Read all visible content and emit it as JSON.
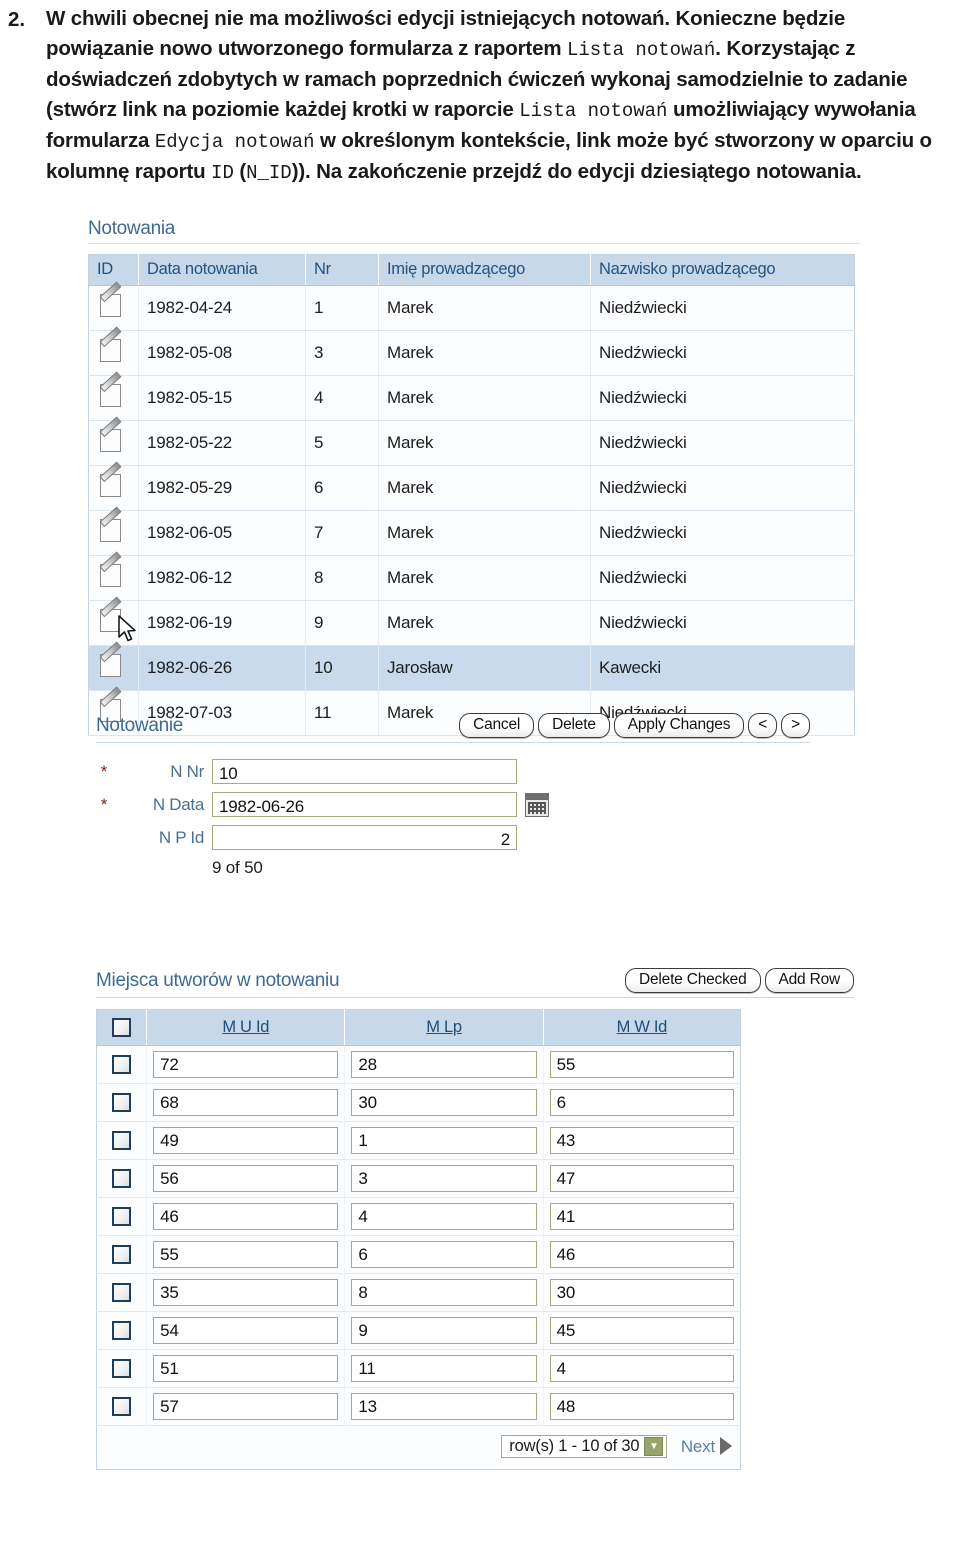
{
  "instruction": {
    "number": "2.",
    "segments": [
      {
        "t": "W chwili obecnej nie ma możliwości edycji istniejących notowań. Konieczne będzie powiązanie nowo utworzonego formularza z raportem ",
        "mono": false
      },
      {
        "t": "Lista notowań",
        "mono": true
      },
      {
        "t": ". Korzystając z doświadczeń zdobytych w ramach poprzednich ćwiczeń wykonaj samodzielnie to zadanie (stwórz link na poziomie każdej krotki w raporcie ",
        "mono": false
      },
      {
        "t": "Lista notowań",
        "mono": true
      },
      {
        "t": " umożliwiający wywołania formularza ",
        "mono": false
      },
      {
        "t": "Edycja notowań",
        "mono": true
      },
      {
        "t": " w określonym kontekście, link może być stworzony w oparciu o kolumnę raportu ",
        "mono": false
      },
      {
        "t": "ID",
        "mono": true
      },
      {
        "t": " (",
        "mono": false
      },
      {
        "t": "N_ID",
        "mono": true
      },
      {
        "t": ")). Na zakończenie przejdź do edycji dziesiątego notowania.",
        "mono": false
      }
    ]
  },
  "report": {
    "title": "Notowania",
    "columns": [
      "ID",
      "Data notowania",
      "Nr",
      "Imię prowadzącego",
      "Nazwisko prowadzącego"
    ],
    "rows": [
      {
        "edit": "edit-pencil-icon",
        "data": "1982-04-24",
        "nr": "1",
        "imie": "Marek",
        "nazwisko": "Niedźwiecki",
        "selected": false
      },
      {
        "edit": "edit-pencil-icon",
        "data": "1982-05-08",
        "nr": "3",
        "imie": "Marek",
        "nazwisko": "Niedźwiecki",
        "selected": false
      },
      {
        "edit": "edit-pencil-icon",
        "data": "1982-05-15",
        "nr": "4",
        "imie": "Marek",
        "nazwisko": "Niedźwiecki",
        "selected": false
      },
      {
        "edit": "edit-pencil-icon",
        "data": "1982-05-22",
        "nr": "5",
        "imie": "Marek",
        "nazwisko": "Niedźwiecki",
        "selected": false
      },
      {
        "edit": "edit-pencil-icon",
        "data": "1982-05-29",
        "nr": "6",
        "imie": "Marek",
        "nazwisko": "Niedźwiecki",
        "selected": false
      },
      {
        "edit": "edit-pencil-icon",
        "data": "1982-06-05",
        "nr": "7",
        "imie": "Marek",
        "nazwisko": "Niedźwiecki",
        "selected": false
      },
      {
        "edit": "edit-pencil-icon",
        "data": "1982-06-12",
        "nr": "8",
        "imie": "Marek",
        "nazwisko": "Niedźwiecki",
        "selected": false
      },
      {
        "edit": "edit-pencil-icon",
        "data": "1982-06-19",
        "nr": "9",
        "imie": "Marek",
        "nazwisko": "Niedźwiecki",
        "selected": false
      },
      {
        "edit": "edit-pencil-icon",
        "data": "1982-06-26",
        "nr": "10",
        "imie": "Jarosław",
        "nazwisko": "Kawecki",
        "selected": true
      },
      {
        "edit": "edit-pencil-icon",
        "data": "1982-07-03",
        "nr": "11",
        "imie": "Marek",
        "nazwisko": "Niedźwiecki",
        "selected": false
      }
    ]
  },
  "form": {
    "title": "Notowanie",
    "buttons": [
      {
        "label": "Cancel",
        "name": "cancel-button"
      },
      {
        "label": "Delete",
        "name": "delete-button"
      },
      {
        "label": "Apply Changes",
        "name": "apply-changes-button"
      },
      {
        "label": "<",
        "name": "previous-record-button"
      },
      {
        "label": ">",
        "name": "next-record-button"
      }
    ],
    "fields": [
      {
        "label": "N Nr",
        "value": "10",
        "required": true,
        "align": "left",
        "datepicker": false
      },
      {
        "label": "N Data",
        "value": "1982-06-26",
        "required": true,
        "align": "left",
        "datepicker": true
      },
      {
        "label": "N P Id",
        "value": "2",
        "required": false,
        "align": "right",
        "datepicker": false
      }
    ],
    "required_marker": "*",
    "record_counter": "9 of 50"
  },
  "tabular": {
    "title": "Miejsca utworów w notowaniu",
    "buttons": [
      {
        "label": "Delete Checked",
        "name": "delete-checked-button"
      },
      {
        "label": "Add Row",
        "name": "add-row-button"
      }
    ],
    "columns": [
      "M U Id",
      "M Lp",
      "M W Id"
    ],
    "rows": [
      {
        "checked": false,
        "m_u_id": "72",
        "m_lp": "28",
        "m_w_id": "55"
      },
      {
        "checked": false,
        "m_u_id": "68",
        "m_lp": "30",
        "m_w_id": "6"
      },
      {
        "checked": false,
        "m_u_id": "49",
        "m_lp": "1",
        "m_w_id": "43"
      },
      {
        "checked": false,
        "m_u_id": "56",
        "m_lp": "3",
        "m_w_id": "47"
      },
      {
        "checked": false,
        "m_u_id": "46",
        "m_lp": "4",
        "m_w_id": "41"
      },
      {
        "checked": false,
        "m_u_id": "55",
        "m_lp": "6",
        "m_w_id": "46"
      },
      {
        "checked": false,
        "m_u_id": "35",
        "m_lp": "8",
        "m_w_id": "30"
      },
      {
        "checked": false,
        "m_u_id": "54",
        "m_lp": "9",
        "m_w_id": "45"
      },
      {
        "checked": false,
        "m_u_id": "51",
        "m_lp": "11",
        "m_w_id": "4"
      },
      {
        "checked": false,
        "m_u_id": "57",
        "m_lp": "13",
        "m_w_id": "48"
      }
    ],
    "pagination": {
      "range_label": "row(s) 1 - 10 of 30",
      "next_label": "Next"
    }
  },
  "colors": {
    "header_bg": "#c7d8ea",
    "header_text": "#24537e",
    "row_highlight": "#c9daec",
    "region_title": "#3d6b96",
    "input_border": "#a9a97d",
    "required_star": "#8e1616",
    "select_arrow": "#97a36a"
  }
}
